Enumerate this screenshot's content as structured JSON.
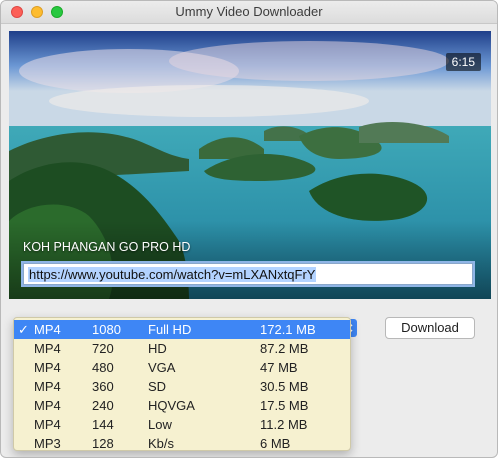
{
  "window": {
    "title": "Ummy Video Downloader"
  },
  "video": {
    "duration": "6:15",
    "title": "KOH PHANGAN GO PRO HD",
    "url": "https://www.youtube.com/watch?v=mLXANxtqFrY"
  },
  "actions": {
    "download_label": "Download"
  },
  "formats": [
    {
      "check": "✓",
      "format": "MP4",
      "resolution": "1080",
      "quality": "Full HD",
      "size": "172.1 MB",
      "selected": true
    },
    {
      "check": "",
      "format": "MP4",
      "resolution": "720",
      "quality": "HD",
      "size": "87.2 MB",
      "selected": false
    },
    {
      "check": "",
      "format": "MP4",
      "resolution": "480",
      "quality": "VGA",
      "size": "47 MB",
      "selected": false
    },
    {
      "check": "",
      "format": "MP4",
      "resolution": "360",
      "quality": "SD",
      "size": "30.5 MB",
      "selected": false
    },
    {
      "check": "",
      "format": "MP4",
      "resolution": "240",
      "quality": "HQVGA",
      "size": "17.5 MB",
      "selected": false
    },
    {
      "check": "",
      "format": "MP4",
      "resolution": "144",
      "quality": "Low",
      "size": "11.2 MB",
      "selected": false
    },
    {
      "check": "",
      "format": "MP3",
      "resolution": "128",
      "quality": "Kb/s",
      "size": "6 MB",
      "selected": false
    }
  ],
  "icons": {
    "checkmark": "checkmark-icon",
    "popup": "chevron-updown-icon"
  },
  "colors": {
    "accent": "#3e86f5",
    "menu_bg": "#f6f1d0",
    "url_selection": "#b3d3ff"
  }
}
